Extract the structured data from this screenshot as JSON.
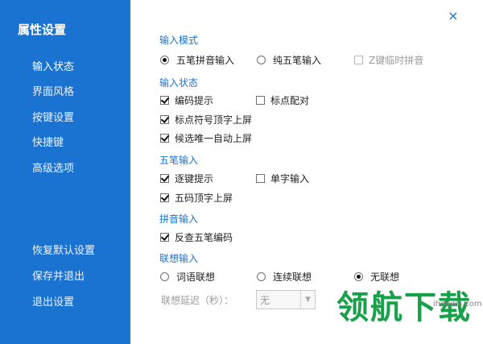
{
  "sidebar": {
    "title": "属性设置",
    "items": [
      {
        "label": "输入状态"
      },
      {
        "label": "界面风格"
      },
      {
        "label": "按键设置"
      },
      {
        "label": "快捷键"
      },
      {
        "label": "高级选项"
      }
    ],
    "bottom_items": [
      {
        "label": "恢复默认设置"
      },
      {
        "label": "保存并退出"
      },
      {
        "label": "退出设置"
      }
    ]
  },
  "close_symbol": "×",
  "sections": {
    "input_mode": {
      "title": "输入模式",
      "options": {
        "wubi_pinyin": "五笔拼音输入",
        "pure_wubi": "纯五笔输入",
        "z_temp_pinyin": "Z键临时拼音"
      }
    },
    "input_state": {
      "title": "输入状态",
      "options": {
        "code_hint": "编码提示",
        "punct_pair": "标点配对",
        "punct_commit": "标点符号顶字上屏",
        "unique_commit": "候选唯一自动上屏"
      }
    },
    "wubi": {
      "title": "五笔输入",
      "options": {
        "key_hint": "逐键提示",
        "single_char": "单字输入",
        "five_code": "五码顶字上屏"
      }
    },
    "pinyin": {
      "title": "拼音输入",
      "options": {
        "reverse_lookup": "反查五笔编码"
      }
    },
    "association": {
      "title": "联想输入",
      "options": {
        "word": "词语联想",
        "continuous": "连续联想",
        "none": "无联想"
      },
      "delay_label": "联想延迟（秒）：",
      "delay_value": "无"
    }
  },
  "watermark": {
    "main": "领航下载",
    "sub": "ihdown.com"
  }
}
